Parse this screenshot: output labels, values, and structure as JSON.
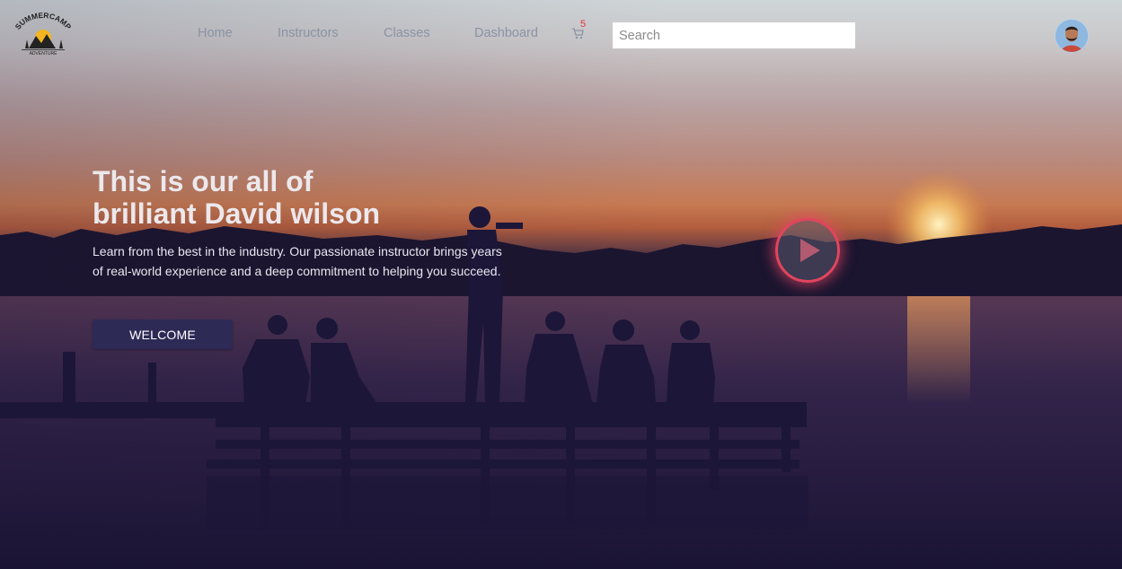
{
  "nav": {
    "links": [
      "Home",
      "Instructors",
      "Classes",
      "Dashboard"
    ],
    "cart_count": "5",
    "search_placeholder": "Search"
  },
  "logo": {
    "text_top": "SUMMERCAMP",
    "text_bottom": "ADVENTURE"
  },
  "hero": {
    "headline_line1": "This is our all of",
    "headline_line2": "brilliant David wilson",
    "description": "Learn from the best in the industry. Our passionate instructor brings years of real-world experience and a deep commitment to helping you succeed.",
    "button_label": "WELCOME"
  },
  "colors": {
    "accent": "#2e2a56",
    "play_ring": "#e0455e",
    "badge": "#e8323c"
  },
  "icons": {
    "cart": "cart-icon",
    "play": "play-icon",
    "avatar": "avatar"
  }
}
